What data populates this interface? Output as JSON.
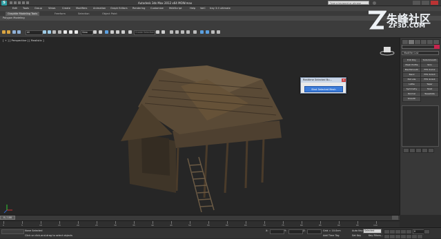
{
  "window": {
    "app_icon": "3ds-max-logo",
    "title": "Autodesk 3ds Max 2012 x64     MOW.max",
    "search_placeholder": "Type a keyword or phrase"
  },
  "menu": [
    "Edit",
    "Tools",
    "Group",
    "Views",
    "Create",
    "Modifiers",
    "Animation",
    "Graph Editors",
    "Rendering",
    "Customize",
    "MAXScript",
    "Help",
    "VoiC",
    "Iray 3.0 ultimate"
  ],
  "ribbon": {
    "tabs": [
      "Graphite Modeling Tools",
      "Freeform",
      "Selection",
      "Object Paint"
    ],
    "panel_label": "Polygon Modeling"
  },
  "toolbar": {
    "filter_label": "All",
    "view_label": "View",
    "named_selection_placeholder": "Create Selection Se"
  },
  "viewport": {
    "label": "[ + ] [ Perspective ] [ Realistic ]"
  },
  "dialog": {
    "title": "Realtime Selected Bu...",
    "close_icon": "close-icon",
    "button_label": "Bind Selected Mesh"
  },
  "command_panel": {
    "modifier_list": "Modifier List",
    "modifier_buttons": [
      [
        "Edit Poly",
        "TurboSmooth"
      ],
      [
        "Mesh Profile",
        "Skin"
      ],
      [
        "MeshSmooth",
        "FFD 2x2x2"
      ],
      [
        "Bend",
        "FFD 3x3x3"
      ],
      [
        "Extrude",
        "FFD 4x4x4"
      ],
      [
        "Lathe",
        "Taper"
      ],
      [
        "Symmetry",
        "Twist"
      ],
      [
        "Normal",
        "Tessellate"
      ],
      [
        "Smooth",
        ""
      ]
    ]
  },
  "watermark": {
    "chinese": "朱峰社区",
    "url": "ZF3D.COM"
  },
  "timeline": {
    "frame_display": "0 / 100",
    "ticks": [
      "0",
      "5",
      "10",
      "15",
      "20",
      "25",
      "30",
      "35",
      "40",
      "45",
      "50",
      "55",
      "60",
      "65",
      "70",
      "75",
      "80",
      "85",
      "90",
      "95",
      "100"
    ]
  },
  "status": {
    "selection_info": "None Selected",
    "prompt": "Click or click-and-drag to select objects",
    "script_field": "",
    "x_label": "X:",
    "y_label": "Y:",
    "z_label": "Z:",
    "grid_label": "Grid = 10.0cm",
    "auto_key": "Auto Key",
    "set_key": "Set Key",
    "selected_dropdown": "Selected",
    "key_filters": "Key Filters...",
    "add_time_tag": "Add Time Tag",
    "frame_field": "0"
  }
}
